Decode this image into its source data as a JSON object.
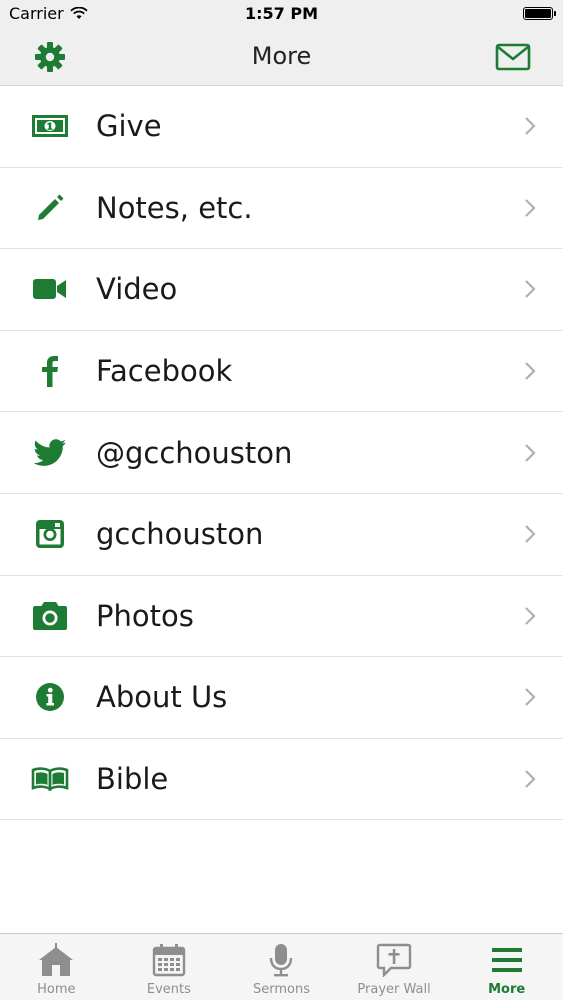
{
  "status_bar": {
    "carrier": "Carrier",
    "time": "1:57 PM",
    "battery_level": 1.0
  },
  "nav": {
    "title": "More",
    "left_icon": "gear-icon",
    "right_icon": "envelope-icon"
  },
  "colors": {
    "accent": "#1e7b34",
    "chevron": "#b0b0b0",
    "tab_inactive": "#8e8e8e"
  },
  "menu": {
    "items": [
      {
        "label": "Give",
        "icon": "money-icon"
      },
      {
        "label": "Notes, etc.",
        "icon": "pencil-icon"
      },
      {
        "label": "Video",
        "icon": "video-camera-icon"
      },
      {
        "label": "Facebook",
        "icon": "facebook-icon"
      },
      {
        "label": "@gcchouston",
        "icon": "twitter-icon"
      },
      {
        "label": "gcchouston",
        "icon": "instagram-icon"
      },
      {
        "label": "Photos",
        "icon": "camera-icon"
      },
      {
        "label": "About Us",
        "icon": "info-icon"
      },
      {
        "label": "Bible",
        "icon": "book-icon"
      }
    ]
  },
  "tabs": [
    {
      "label": "Home",
      "icon": "home-icon",
      "active": false
    },
    {
      "label": "Events",
      "icon": "calendar-icon",
      "active": false
    },
    {
      "label": "Sermons",
      "icon": "microphone-icon",
      "active": false
    },
    {
      "label": "Prayer Wall",
      "icon": "prayer-wall-icon",
      "active": false
    },
    {
      "label": "More",
      "icon": "menu-icon",
      "active": true
    }
  ]
}
